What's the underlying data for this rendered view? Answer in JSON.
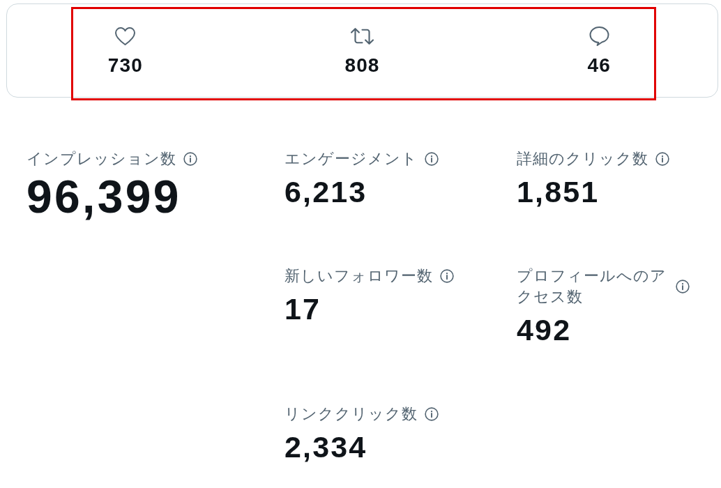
{
  "engagement_bar": {
    "highlighted": true,
    "stats": [
      {
        "kind": "like",
        "count": "730"
      },
      {
        "kind": "repost",
        "count": "808"
      },
      {
        "kind": "reply",
        "count": "46"
      }
    ]
  },
  "primary_metric": {
    "label": "インプレッション数",
    "value": "96,399"
  },
  "metrics": [
    {
      "label": "エンゲージメント",
      "value": "6,213"
    },
    {
      "label": "詳細のクリック数",
      "value": "1,851"
    },
    {
      "label": "新しいフォロワー数",
      "value": "17"
    },
    {
      "label": "プロフィールへのアクセス数",
      "value": "492"
    },
    {
      "label": "リンククリック数",
      "value": "2,334"
    }
  ]
}
